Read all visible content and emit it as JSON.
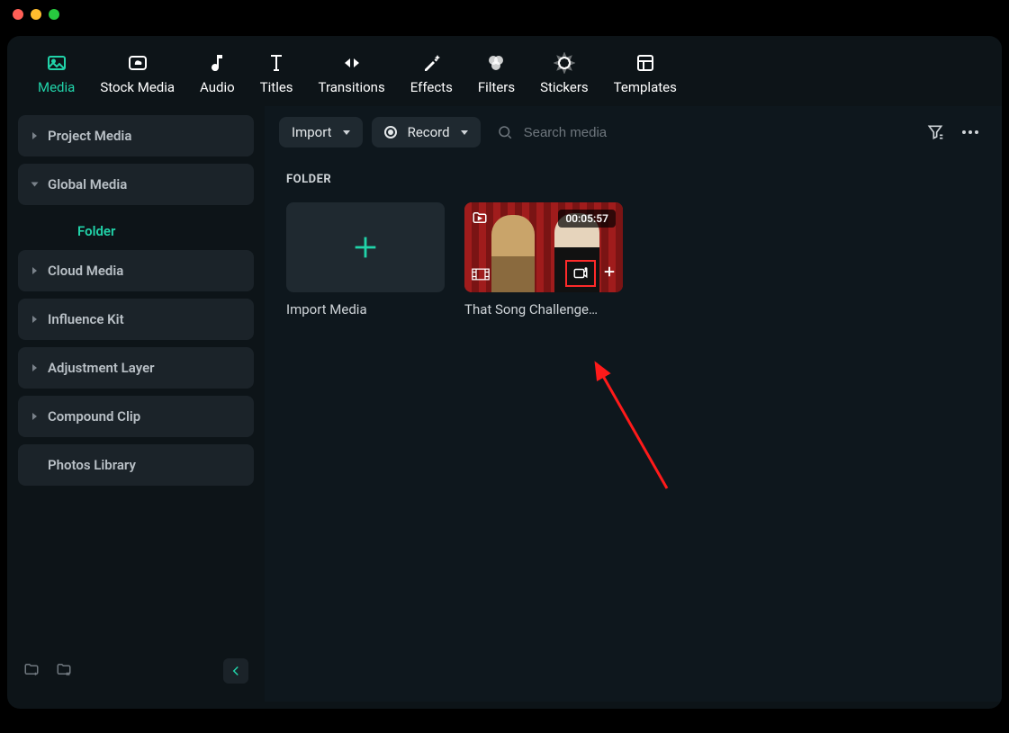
{
  "tabs": [
    {
      "label": "Media"
    },
    {
      "label": "Stock Media"
    },
    {
      "label": "Audio"
    },
    {
      "label": "Titles"
    },
    {
      "label": "Transitions"
    },
    {
      "label": "Effects"
    },
    {
      "label": "Filters"
    },
    {
      "label": "Stickers"
    },
    {
      "label": "Templates"
    }
  ],
  "sidebar": {
    "project_media": "Project Media",
    "global_media": "Global Media",
    "folder": "Folder",
    "cloud_media": "Cloud Media",
    "influence_kit": "Influence Kit",
    "adjustment_layer": "Adjustment Layer",
    "compound_clip": "Compound Clip",
    "photos_library": "Photos Library"
  },
  "toolbar": {
    "import_label": "Import",
    "record_label": "Record",
    "search_placeholder": "Search media"
  },
  "section": {
    "title": "FOLDER"
  },
  "media": {
    "import_tile_label": "Import Media",
    "video_tile_label": "That Song Challenge…",
    "video_duration": "00:05:57"
  }
}
